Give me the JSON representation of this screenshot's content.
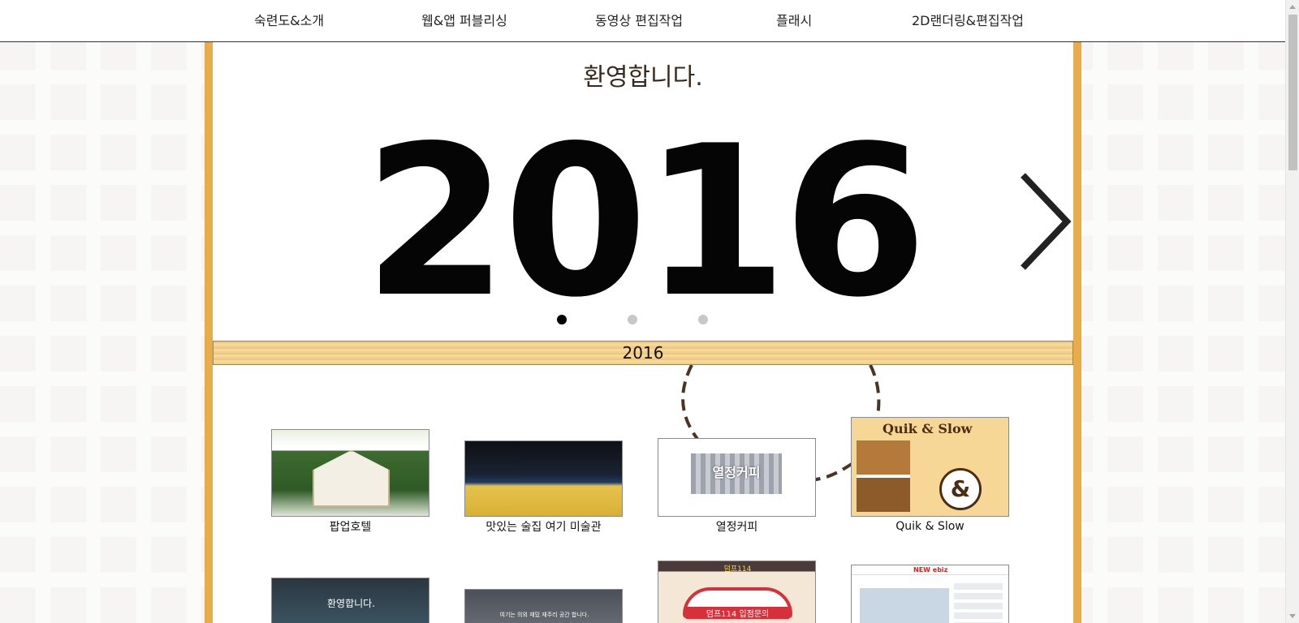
{
  "nav": {
    "items": [
      {
        "label": "숙련도&소개"
      },
      {
        "label": "웹&앱 퍼블리싱"
      },
      {
        "label": "동영상 편집작업"
      },
      {
        "label": "플래시"
      },
      {
        "label": "2D랜더링&편집작업"
      }
    ]
  },
  "hero": {
    "welcome": "환영합니다.",
    "slide_year": "2016",
    "active_dot": 0,
    "dot_count": 3
  },
  "section": {
    "year_label": "2016"
  },
  "portfolio": {
    "row1": [
      {
        "caption": "팝업호텔"
      },
      {
        "caption": "맛있는 술집 여기 미술관"
      },
      {
        "caption": "열정커피",
        "brand": "열정커피"
      },
      {
        "caption": "Quik & Slow",
        "brand": "Quik & Slow"
      }
    ],
    "row2": [
      {
        "preview_text": "환영합니다."
      },
      {
        "preview_text": "여기는 의외 재밌 재주리 공간 합니다."
      },
      {
        "preview_text": "덤프114",
        "ribbon": "덤프114 입점문의"
      },
      {
        "preview_text": "NEW ebiz"
      }
    ]
  },
  "colors": {
    "frame": "#e8ad4a",
    "accent_text": "#3a2a1e",
    "dot_active": "#000000",
    "dot_inactive": "#c8c8c8"
  }
}
